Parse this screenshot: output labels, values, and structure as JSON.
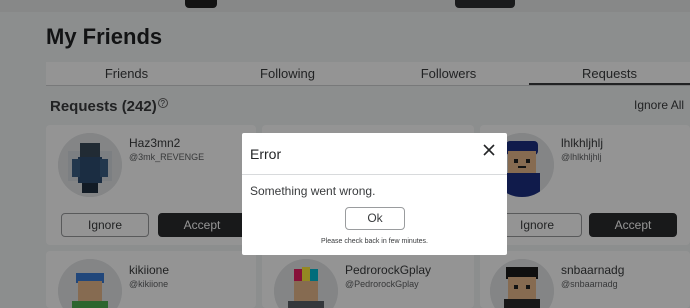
{
  "page": {
    "title": "My Friends"
  },
  "tabs": [
    {
      "label": "Friends"
    },
    {
      "label": "Following"
    },
    {
      "label": "Followers"
    },
    {
      "label": "Requests",
      "active": true
    }
  ],
  "requests": {
    "header": "Requests (242)",
    "help_icon": "question-circle-icon",
    "ignore_all_label": "Ignore All",
    "ignore_label": "Ignore",
    "accept_label": "Accept",
    "cards": [
      {
        "name": "Haz3mn2",
        "handle": "@3mk_REVENGE"
      },
      {
        "name": "lhlkhljhlj",
        "handle": "@lhlkhljhlj"
      },
      {
        "name": "kikiione",
        "handle": "@kikiione"
      },
      {
        "name": "PedrorockGplay",
        "handle": "@PedrorockGplay"
      },
      {
        "name": "snbaarnadg",
        "handle": "@snbaarnadg"
      }
    ]
  },
  "modal": {
    "title": "Error",
    "message": "Something went wrong.",
    "ok_label": "Ok",
    "note": "Please check back in few minutes.",
    "close_icon": "close-icon"
  }
}
